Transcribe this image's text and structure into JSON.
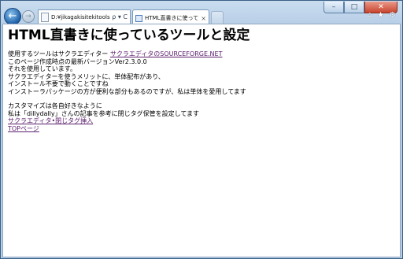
{
  "browser": {
    "address": "D:¥jikagakisitekitools.html",
    "address_tools": "ρ ▾ C",
    "tab_title": "HTML直書きに使っているツールと設定",
    "tab_close": "×",
    "caption": {
      "minimize": "–",
      "maximize": "□",
      "close": "✕"
    },
    "right_icons": {
      "home": "⌂",
      "favorites": "★",
      "tools": "⚙"
    }
  },
  "page": {
    "title": "HTML直書きに使っているツールと設定",
    "line1_text": "使用するツールはサクラエディター ",
    "line1_link": "サクラエディタのSOURCEFORGE.NET",
    "line2": "このページ作成時点の最新バージョンVer2.3.0.0",
    "line3": "それを使用しています。",
    "line4": "サクラエディターを使うメリットに、単体配布があり、",
    "line5": "インストール不要で動くことですね",
    "line6": "インストーラパッケージの方が便利な部分もあるのですが、私は単体を愛用してます",
    "line7": "カスタマイズは各自好きなように",
    "line8": "私は「dillydally」さんの記事を参考に閉じタグ保管を設定してます",
    "link2": "サクラエディタ•閉じタグ挿入",
    "link3": "TOPページ"
  }
}
